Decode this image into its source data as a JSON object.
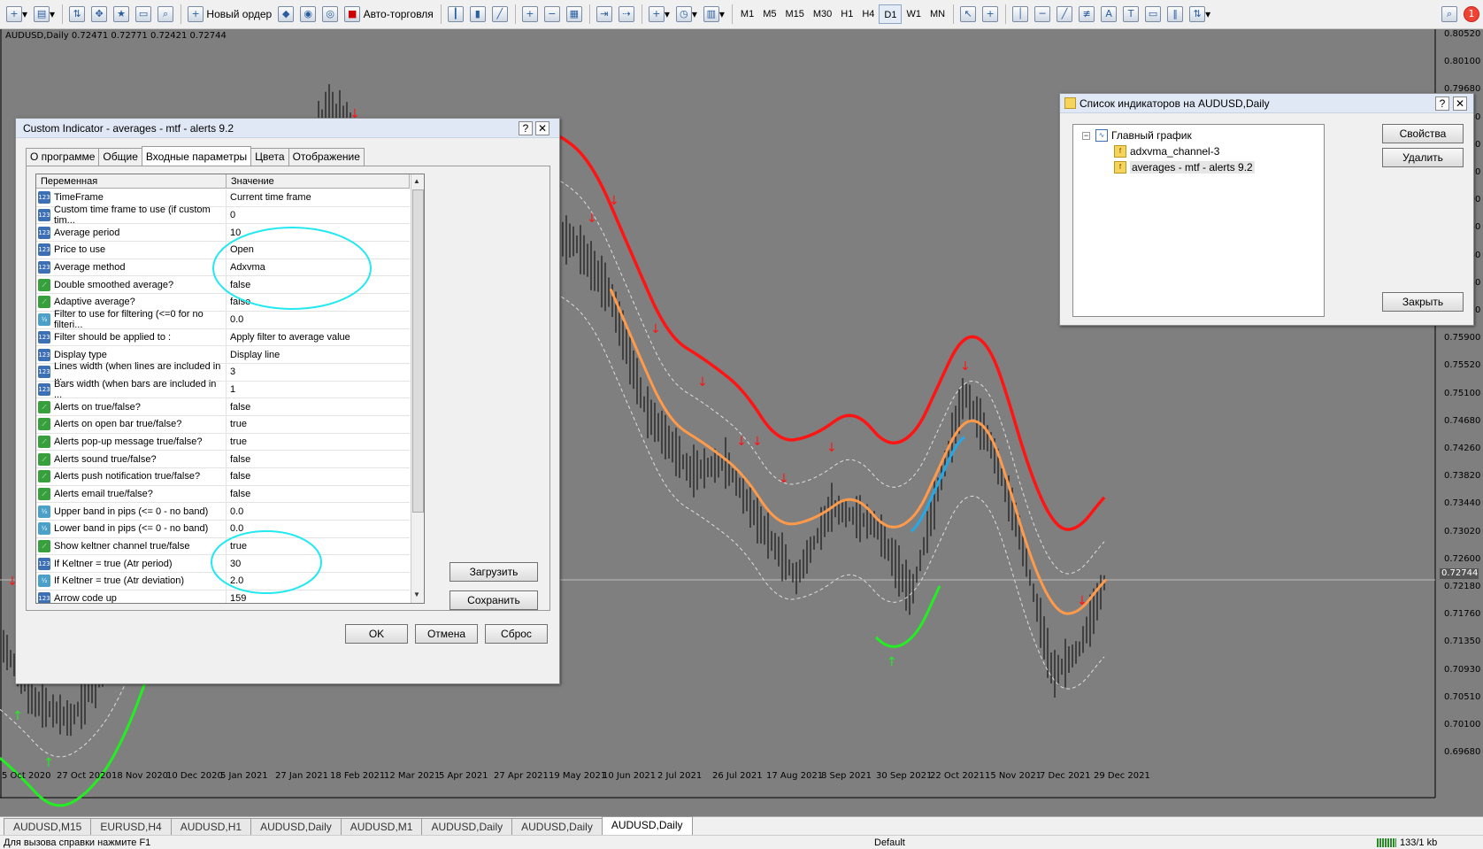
{
  "toolbar": {
    "new_order": "Новый ордер",
    "auto_trading": "Авто-торговля",
    "timeframes": [
      "M1",
      "M5",
      "M15",
      "M30",
      "H1",
      "H4",
      "D1",
      "W1",
      "MN"
    ],
    "active_timeframe": "D1"
  },
  "chart": {
    "info": "AUDUSD,Daily  0.72471 0.72771 0.72421 0.72744",
    "current_price": "0.72744",
    "price_labels": [
      "0.80520",
      "0.80100",
      "0.79680",
      "0.79260",
      "0.78840",
      "0.78420",
      "0.78000",
      "0.77580",
      "0.77160",
      "0.76740",
      "0.76320",
      "0.75900",
      "0.75520",
      "0.75100",
      "0.74680",
      "0.74260",
      "0.73820",
      "0.73440",
      "0.73020",
      "0.72600",
      "0.72180",
      "0.71760",
      "0.71350",
      "0.70930",
      "0.70510",
      "0.70100",
      "0.69680"
    ],
    "date_labels": [
      "5 Oct 2020",
      "27 Oct 2020",
      "18 Nov 2020",
      "10 Dec 2020",
      "5 Jan 2021",
      "27 Jan 2021",
      "18 Feb 2021",
      "12 Mar 2021",
      "5 Apr 2021",
      "27 Apr 2021",
      "19 May 2021",
      "10 Jun 2021",
      "2 Jul 2021",
      "26 Jul 2021",
      "17 Aug 2021",
      "8 Sep 2021",
      "30 Sep 2021",
      "22 Oct 2021",
      "15 Nov 2021",
      "7 Dec 2021",
      "29 Dec 2021"
    ],
    "colors": {
      "background": "#7f7f7f",
      "upper_band": "#ff1414",
      "average": "#ff9a4a",
      "average_up": "#23a8e8",
      "lower_band": "#22ee22",
      "candles": "#000000",
      "arrow_down": "#ff1414",
      "arrow_up": "#22ee22"
    }
  },
  "custom_indicator": {
    "title": "Custom Indicator - averages - mtf - alerts  9.2",
    "help_button": "?",
    "close_button": "✕",
    "tabs": [
      "О программе",
      "Общие",
      "Входные параметры",
      "Цвета",
      "Отображение"
    ],
    "active_tab": "Входные параметры",
    "columns": [
      "Переменная",
      "Значение"
    ],
    "params": [
      {
        "icon": "123",
        "name": "TimeFrame",
        "value": "Current time frame"
      },
      {
        "icon": "123",
        "name": "Custom time frame to use (if custom tim...",
        "value": "0"
      },
      {
        "icon": "123",
        "name": "Average period",
        "value": "10"
      },
      {
        "icon": "123",
        "name": "Price to use",
        "value": "Open"
      },
      {
        "icon": "123",
        "name": "Average method",
        "value": "Adxvma"
      },
      {
        "icon": "bool",
        "name": "Double smoothed average?",
        "value": "false"
      },
      {
        "icon": "bool",
        "name": "Adaptive average?",
        "value": "false"
      },
      {
        "icon": "dbl",
        "name": "Filter to use for filtering (<=0 for no filteri...",
        "value": "0.0"
      },
      {
        "icon": "123",
        "name": "Filter should be applied to :",
        "value": "Apply filter to average value"
      },
      {
        "icon": "123",
        "name": "Display type",
        "value": "Display line"
      },
      {
        "icon": "123",
        "name": "Lines width (when lines are included in ...",
        "value": "3"
      },
      {
        "icon": "123",
        "name": "Bars width (when bars are included in ...",
        "value": "1"
      },
      {
        "icon": "bool",
        "name": "Alerts on true/false?",
        "value": "false"
      },
      {
        "icon": "bool",
        "name": "Alerts on open bar true/false?",
        "value": "true"
      },
      {
        "icon": "bool",
        "name": "Alerts pop-up message true/false?",
        "value": "true"
      },
      {
        "icon": "bool",
        "name": "Alerts sound true/false?",
        "value": "false"
      },
      {
        "icon": "bool",
        "name": "Alerts push notification true/false?",
        "value": "false"
      },
      {
        "icon": "bool",
        "name": "Alerts email true/false?",
        "value": "false"
      },
      {
        "icon": "dbl",
        "name": "Upper band in pips (<= 0 - no band)",
        "value": "0.0"
      },
      {
        "icon": "dbl",
        "name": "Lower band in pips (<= 0 - no band)",
        "value": "0.0"
      },
      {
        "icon": "bool",
        "name": "Show keltner channel true/false",
        "value": "true"
      },
      {
        "icon": "123",
        "name": "If Keltner = true (Atr period)",
        "value": "30"
      },
      {
        "icon": "dbl",
        "name": "If Keltner = true (Atr deviation)",
        "value": "2.0"
      },
      {
        "icon": "123",
        "name": "Arrow code up",
        "value": "159"
      },
      {
        "icon": "123",
        "name": "Arrow code down",
        "value": "159"
      }
    ],
    "load_button": "Загрузить",
    "save_button": "Сохранить",
    "ok_button": "OK",
    "cancel_button": "Отмена",
    "reset_button": "Сброс"
  },
  "indicator_list": {
    "title": "Список индикаторов на AUDUSD,Daily",
    "help_button": "?",
    "close_button": "✕",
    "tree_root": "Главный график",
    "tree_items": [
      "adxvma_channel-3",
      "averages - mtf - alerts  9.2"
    ],
    "properties_button": "Свойства",
    "delete_button": "Удалить",
    "close_dialog_button": "Закрыть"
  },
  "chart_tabs": [
    "AUDUSD,M15",
    "EURUSD,H4",
    "AUDUSD,H1",
    "AUDUSD,Daily",
    "AUDUSD,M1",
    "AUDUSD,Daily",
    "AUDUSD,Daily",
    "AUDUSD,Daily"
  ],
  "active_chart_tab": "AUDUSD,Daily",
  "status": {
    "help": "Для вызова справки нажмите F1",
    "profile": "Default",
    "traffic": "133/1 kb"
  }
}
